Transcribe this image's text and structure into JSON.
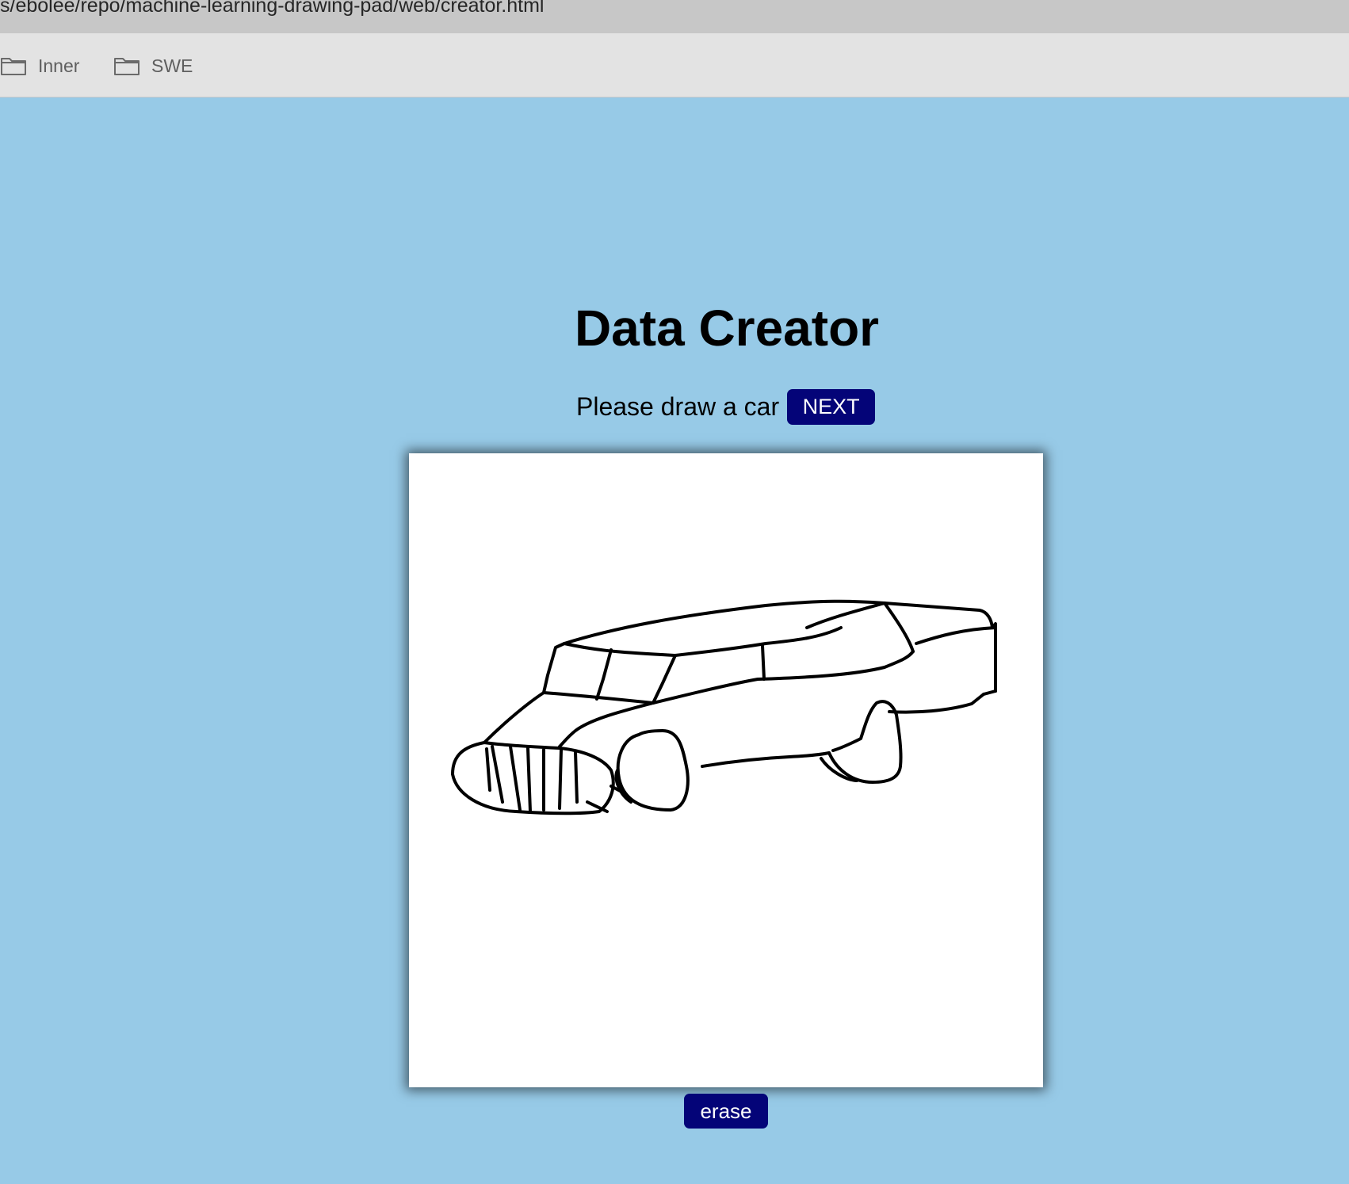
{
  "browser": {
    "url": "s/ebolee/repo/machine-learning-drawing-pad/web/creator.html",
    "bookmarks": [
      {
        "label": "Inner",
        "icon": "folder-icon"
      },
      {
        "label": "SWE",
        "icon": "folder-icon"
      }
    ]
  },
  "page": {
    "title": "Data Creator",
    "prompt": "Please draw a car",
    "next_label": "NEXT",
    "erase_label": "erase",
    "background_color": "#97cae7",
    "button_color": "#040478"
  }
}
